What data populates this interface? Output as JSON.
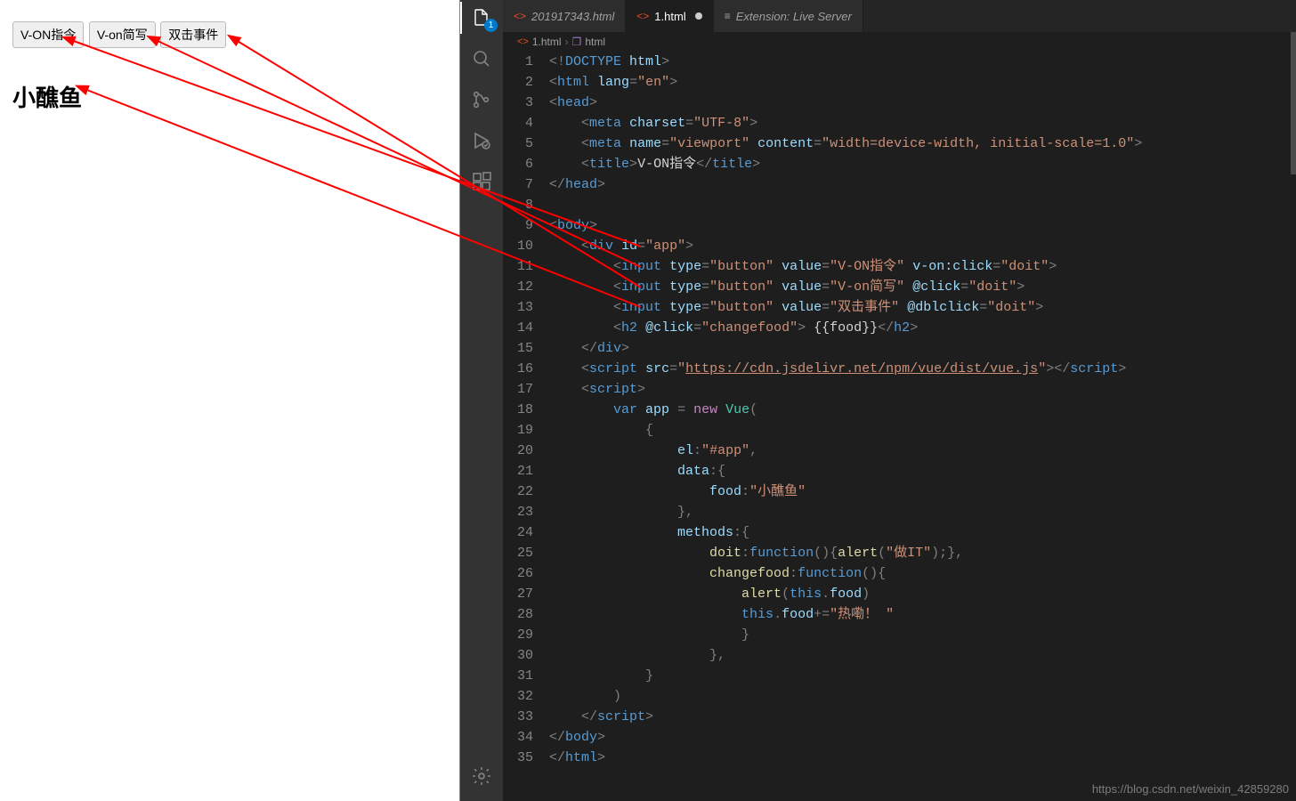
{
  "preview": {
    "buttons": [
      "V-ON指令",
      "V-on简写",
      "双击事件"
    ],
    "heading": "小醮鱼"
  },
  "activity": {
    "explorerBadge": "1"
  },
  "tabs": [
    {
      "label": "201917343.html",
      "active": false,
      "modified": false,
      "kind": "html"
    },
    {
      "label": "1.html",
      "active": true,
      "modified": true,
      "kind": "html"
    },
    {
      "label": "Extension: Live Server",
      "active": false,
      "modified": false,
      "kind": "ext"
    }
  ],
  "breadcrumbs": {
    "file": "1.html",
    "symbol": "html"
  },
  "lineStart": 1,
  "lineEnd": 35,
  "code": {
    "doctype": "<!DOCTYPE html>",
    "htmlOpen": {
      "lang": "en"
    },
    "metaCharset": "UTF-8",
    "metaViewport": {
      "name": "viewport",
      "content": "width=device-width, initial-scale=1.0"
    },
    "title": "V-ON指令",
    "divId": "app",
    "inputs": [
      {
        "value": "V-ON指令",
        "event": "v-on:click",
        "handler": "doit"
      },
      {
        "value": "V-on简写",
        "event": "@click",
        "handler": "doit"
      },
      {
        "value": "双击事件",
        "event": "@dblclick",
        "handler": "doit"
      }
    ],
    "h2": {
      "event": "@click",
      "handler": "changefood",
      "inner": "{{food}}"
    },
    "cdn": "https://cdn.jsdelivr.net/npm/vue/dist/vue.js",
    "vue": {
      "el": "#app",
      "dataFoodKey": "food",
      "dataFoodVal": "小醮鱼",
      "doitAlert": "做IT",
      "changefoodAppend": "热嘞！ "
    }
  },
  "watermark": "https://blog.csdn.net/weixin_42859280"
}
